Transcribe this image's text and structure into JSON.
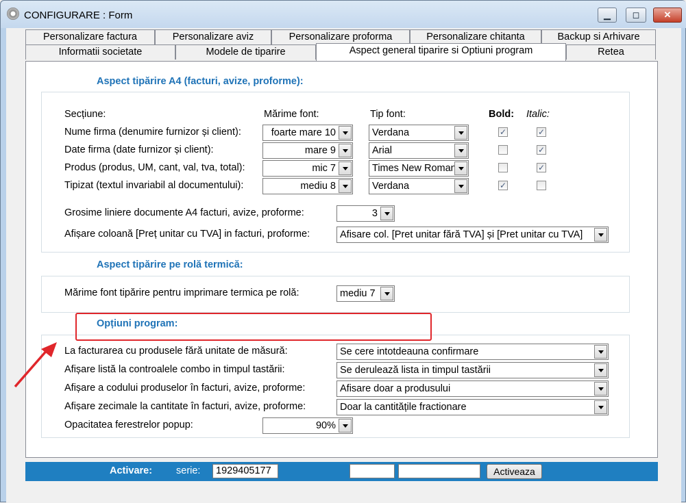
{
  "window": {
    "title": "CONFIGURARE : Form",
    "min": "▁",
    "max": "◻",
    "close": "✕"
  },
  "tabs_row1": [
    "Personalizare factura",
    "Personalizare aviz",
    "Personalizare proforma",
    "Personalizare chitanta",
    "Backup si Arhivare"
  ],
  "tabs_row2": [
    "Informatii societate",
    "Modele de tiparire",
    "Aspect general tiparire si Optiuni program",
    "Retea"
  ],
  "a4": {
    "title": "Aspect tipărire A4 (facturi, avize, proforme):",
    "headers": {
      "section": "Secțiune:",
      "size": "Mărime font:",
      "type": "Tip font:",
      "bold": "Bold:",
      "italic": "Italic:"
    },
    "rows": [
      {
        "label": "Nume firma (denumire furnizor și client):",
        "size": "foarte mare 10",
        "font": "Verdana",
        "bold": true,
        "italic": true
      },
      {
        "label": "Date firma (date furnizor și client):",
        "size": "mare 9",
        "font": "Arial",
        "bold": false,
        "italic": true
      },
      {
        "label": "Produs (produs, UM, cant, val, tva, total):",
        "size": "mic 7",
        "font": "Times New Roman",
        "bold": false,
        "italic": true
      },
      {
        "label": "Tipizat (textul invariabil al documentului):",
        "size": "mediu 8",
        "font": "Verdana",
        "bold": true,
        "italic": false
      }
    ],
    "line_thickness_label": "Grosime liniere documente A4 facturi, avize, proforme:",
    "line_thickness_value": "3",
    "unit_price_col_label": "Afișare coloană [Preț unitar cu TVA] in facturi, proforme:",
    "unit_price_col_value": "Afisare col. [Pret unitar fără TVA] și [Pret unitar cu TVA]"
  },
  "thermal": {
    "title": "Aspect tipărire pe rolă termică:",
    "font_label": "Mărime font tipărire pentru imprimare termica pe rolă:",
    "font_value": "mediu 7"
  },
  "options": {
    "title": "Opțiuni program:",
    "rows": [
      {
        "label": "La facturarea cu produsele fără unitate de măsură:",
        "value": "Se cere intotdeauna confirmare"
      },
      {
        "label": "Afișare listă la controalele combo in timpul tastării:",
        "value": "Se derulează lista in timpul tastării"
      },
      {
        "label": "Afișare a codului produselor în facturi, avize, proforme:",
        "value": "Afisare doar a produsului"
      },
      {
        "label": "Afișare zecimale la cantitate în facturi, avize, proforme:",
        "value": "Doar la cantitățile fractionare"
      }
    ],
    "opacity_label": "Opacitatea ferestrelor popup:",
    "opacity_value": "90%"
  },
  "activation": {
    "label": "Activare:",
    "serie_label": "serie:",
    "serie_value": "1929405177",
    "field2": "",
    "field3": "",
    "button": "Activeaza"
  },
  "colors": {
    "accent": "#1f73b7",
    "bar": "#1f7fc1",
    "highlight": "#e0262b"
  }
}
